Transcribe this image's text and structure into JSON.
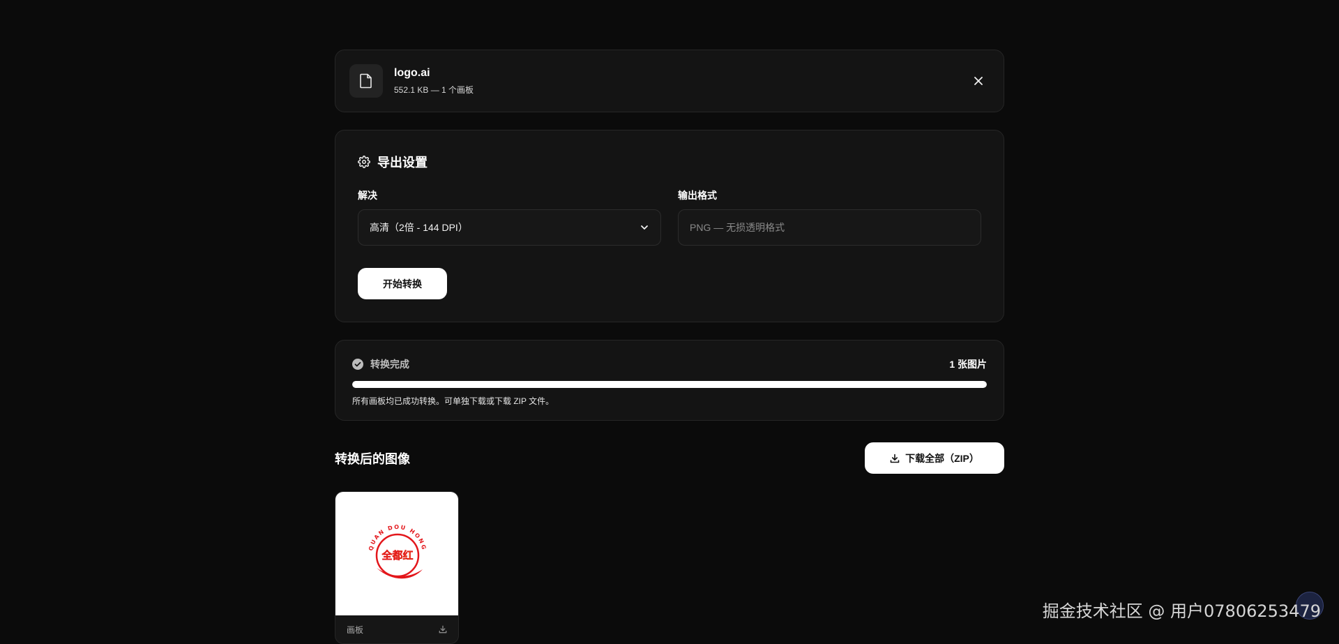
{
  "file": {
    "name": "logo.ai",
    "info": "552.1 KB — 1 个画板",
    "icon": "file-icon",
    "close_icon": "close-icon"
  },
  "settings": {
    "title": "导出设置",
    "icon": "gear-icon",
    "resolution_label": "解决",
    "resolution_value": "高清（2倍 - 144 DPI）",
    "format_label": "输出格式",
    "format_value": "PNG — 无损透明格式",
    "start_label": "开始转换"
  },
  "progress": {
    "status": "转换完成",
    "count": "1 张图片",
    "percent": 100,
    "message": "所有画板均已成功转换。可单独下载或下载 ZIP 文件。"
  },
  "results": {
    "title": "转换后的图像",
    "download_all_label": "下载全部（ZIP）",
    "items": [
      {
        "label": "画板",
        "logo_arc_text": "QUAN DOU HONG",
        "logo_center_text": "全都红"
      }
    ]
  },
  "watermark": "掘金技术社区 @ 用户07806253479",
  "colors": {
    "background": "#0b0b0b",
    "card": "#141414",
    "accent": "#ffffff",
    "logo_red": "#e3161b",
    "logo_yellow": "#f2e600"
  }
}
